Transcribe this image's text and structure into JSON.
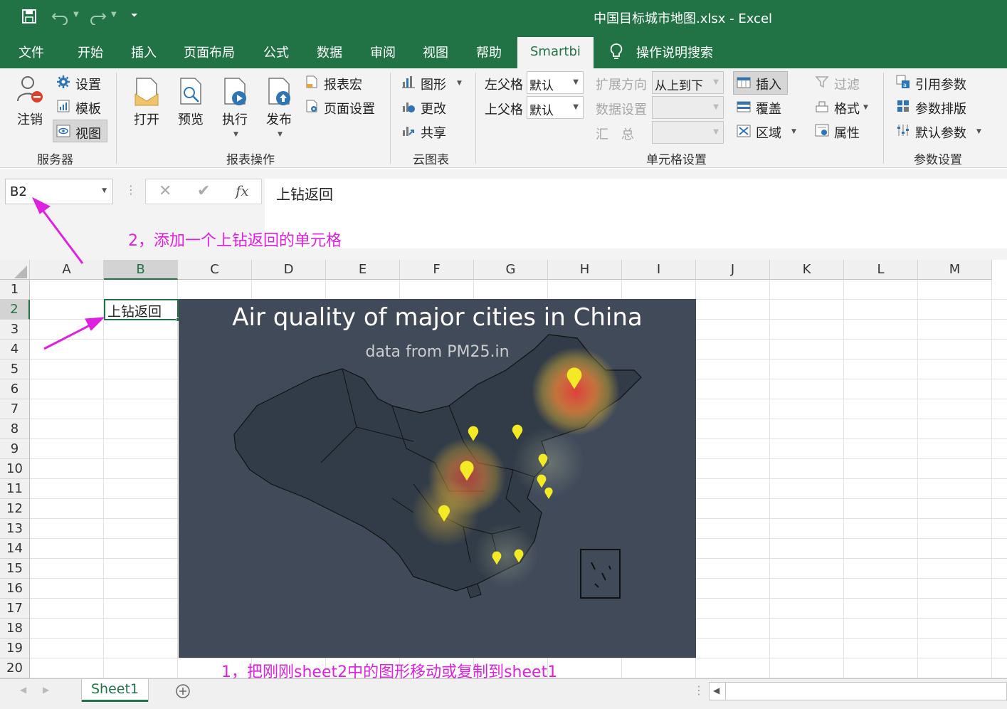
{
  "window": {
    "title": "中国目标城市地图.xlsx  -  Excel"
  },
  "tabs": [
    "文件",
    "开始",
    "插入",
    "页面布局",
    "公式",
    "数据",
    "审阅",
    "视图",
    "帮助",
    "Smartbi",
    "操作说明搜索"
  ],
  "active_tab": "Smartbi",
  "ribbon": {
    "server": {
      "logout": "注销",
      "settings": "设置",
      "template": "模板",
      "view": "视图",
      "group": "服务器"
    },
    "report": {
      "open": "打开",
      "preview": "预览",
      "execute": "执行",
      "publish": "发布",
      "macro": "报表宏",
      "page_setup": "页面设置",
      "group": "报表操作"
    },
    "cloud_chart": {
      "shape": "图形",
      "change": "更改",
      "share": "共享",
      "group": "云图表"
    },
    "cell_settings": {
      "left_parent_label": "左父格",
      "left_parent_value": "默认",
      "top_parent_label": "上父格",
      "top_parent_value": "默认",
      "expand_dir_label": "扩展方向",
      "expand_dir_value": "从上到下",
      "data_settings_label": "数据设置",
      "summary_label": "汇　总",
      "insert": "插入",
      "cover": "覆盖",
      "region": "区域",
      "filter": "过滤",
      "format": "格式",
      "property": "属性",
      "group": "单元格设置"
    },
    "params": {
      "ref_params": "引用参数",
      "param_layout": "参数排版",
      "default_params": "默认参数",
      "group": "参数设置"
    }
  },
  "formula_bar": {
    "name_box": "B2",
    "formula": "上钻返回",
    "fx": "fx"
  },
  "columns": [
    "A",
    "B",
    "C",
    "D",
    "E",
    "F",
    "G",
    "H",
    "I",
    "J",
    "K",
    "L",
    "M"
  ],
  "rows": [
    "1",
    "2",
    "3",
    "4",
    "5",
    "6",
    "7",
    "8",
    "9",
    "10",
    "11",
    "12",
    "13",
    "14",
    "15",
    "16",
    "17",
    "18",
    "19",
    "20"
  ],
  "selected_cell": {
    "ref": "B2",
    "value": "上钻返回"
  },
  "chart": {
    "title": "Air quality of major cities in China",
    "subtitle": "data from PM25.in",
    "background": "#404a59",
    "marker_color": "#f4e925"
  },
  "annotations": {
    "step2": "2，添加一个上钻返回的单元格",
    "step1": "1，把刚刚sheet2中的图形移动或复制到sheet1"
  },
  "sheets": [
    "Sheet1"
  ],
  "colors": {
    "excel_green": "#217346",
    "annotation": "#e020e0"
  }
}
